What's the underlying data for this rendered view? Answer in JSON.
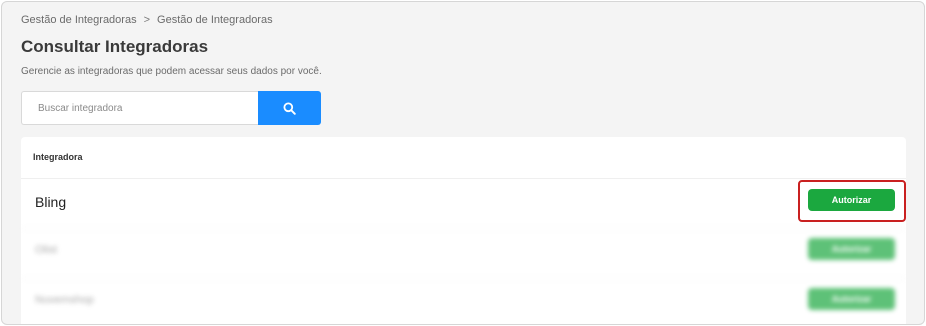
{
  "breadcrumb": {
    "items": [
      "Gestão de Integradoras",
      "Gestão de Integradoras"
    ],
    "separator": ">"
  },
  "page": {
    "title": "Consultar Integradoras",
    "subtitle": "Gerencie as integradoras que podem acessar seus dados por você."
  },
  "search": {
    "placeholder": "Buscar integradora",
    "value": "",
    "button_icon": "search-icon"
  },
  "table": {
    "column_header": "Integradora",
    "rows": [
      {
        "name": "Bling",
        "action_label": "Autorizar",
        "highlighted": true
      },
      {
        "name": "Olist",
        "action_label": "Autorizar",
        "blurred": true
      },
      {
        "name": "Nuvemshop",
        "action_label": "Autorizar",
        "blurred": true
      }
    ]
  },
  "colors": {
    "primary_blue": "#1a8cff",
    "authorize_green": "#1ba83f",
    "highlight_red": "#c92020"
  }
}
